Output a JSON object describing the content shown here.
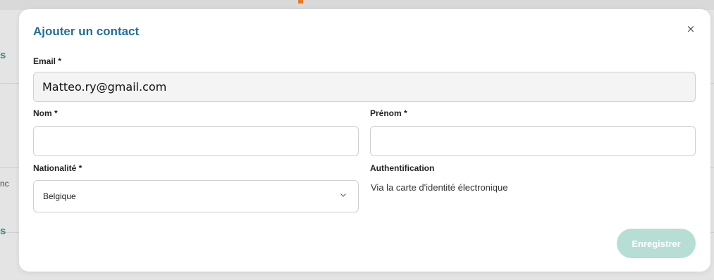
{
  "background": {
    "fragments": [
      "s",
      "nc",
      "s"
    ]
  },
  "modal": {
    "title": "Ajouter un contact",
    "close_icon": "close-icon",
    "close_symbol": "×",
    "email": {
      "label": "Email *",
      "value": "Matteo.ry@gmail.com"
    },
    "nom": {
      "label": "Nom *",
      "value": ""
    },
    "prenom": {
      "label": "Prénom *",
      "value": ""
    },
    "nationalite": {
      "label": "Nationalité *",
      "selected": "Belgique",
      "icon": "chevron-down-icon"
    },
    "authentification": {
      "label": "Authentification",
      "text": "Via la carte d'identité électronique"
    },
    "save_label": "Enregistrer"
  },
  "colors": {
    "title": "#1f6f9a",
    "save_button_disabled": "#b7ded5",
    "background_accent": "#2a8f88",
    "orange_mark": "#e8782a"
  }
}
